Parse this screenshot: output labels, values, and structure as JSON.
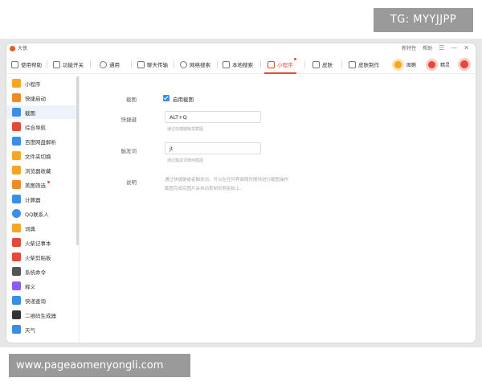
{
  "watermarks": {
    "top": "TG: MYYJJPP",
    "bottom": "www.pageaomenyongli.com"
  },
  "titlebar": {
    "app_name": "大侠",
    "links": [
      "新特性",
      "帮助"
    ],
    "controls": [
      "☰",
      "—",
      "✕"
    ]
  },
  "tabs": [
    {
      "label": "使用帮助",
      "icon": "help-icon"
    },
    {
      "label": "功能开关",
      "icon": "toggle-icon"
    },
    {
      "label": "通用",
      "icon": "settings-icon"
    },
    {
      "label": "聊天传输",
      "icon": "chat-icon"
    },
    {
      "label": "网络搜索",
      "icon": "web-search-icon"
    },
    {
      "label": "本地搜索",
      "icon": "local-search-icon"
    },
    {
      "label": "小程序",
      "icon": "mini-program-icon",
      "active": true
    },
    {
      "label": "皮肤",
      "icon": "shirt-icon"
    },
    {
      "label": "皮肤制作",
      "icon": "skin-make-icon"
    }
  ],
  "right_buttons": [
    {
      "label": "图鹅",
      "color": "#f5a623"
    },
    {
      "label": "精灵",
      "color": "#e24a3b"
    }
  ],
  "sidebar": [
    {
      "label": "小程序",
      "color": "#f5a623"
    },
    {
      "label": "快捷启动",
      "color": "#f08a24"
    },
    {
      "label": "截图",
      "color": "#3a8ee6",
      "active": true
    },
    {
      "label": "综合导航",
      "color": "#e24a3b"
    },
    {
      "label": "百度网盘解析",
      "color": "#3a8ee6"
    },
    {
      "label": "文件夹切换",
      "color": "#f5a623"
    },
    {
      "label": "浏览器收藏",
      "color": "#f5a623"
    },
    {
      "label": "美图筛选",
      "color": "#f08a24",
      "dot": true
    },
    {
      "label": "计算器",
      "color": "#3a8ee6"
    },
    {
      "label": "QQ联系人",
      "color": "#3a8ee6"
    },
    {
      "label": "词典",
      "color": "#f5a623"
    },
    {
      "label": "火柴记事本",
      "color": "#e24a3b"
    },
    {
      "label": "火柴剪贴板",
      "color": "#e24a3b"
    },
    {
      "label": "系统命令",
      "color": "#555555"
    },
    {
      "label": "释义",
      "color": "#8b5cf6"
    },
    {
      "label": "快递查询",
      "color": "#3a8ee6"
    },
    {
      "label": "二维码生成器",
      "color": "#333333"
    },
    {
      "label": "天气",
      "color": "#3a8ee6"
    }
  ],
  "settings": {
    "screenshot_label": "截图",
    "enable_label": "启用截图",
    "hotkey_label": "快捷键",
    "hotkey_value": "ALT+Q",
    "hotkey_hint": "通过快捷键触发截图",
    "keyword_label": "触发词",
    "keyword_value": "jt",
    "keyword_hint": "通过触发词使用截图",
    "desc_label": "说明",
    "desc_line1": "通过快捷键或者触发词，可以在任何界面随时随地进行截图操作",
    "desc_line2": "截图完成后图片会自动复制到剪贴板上。"
  }
}
